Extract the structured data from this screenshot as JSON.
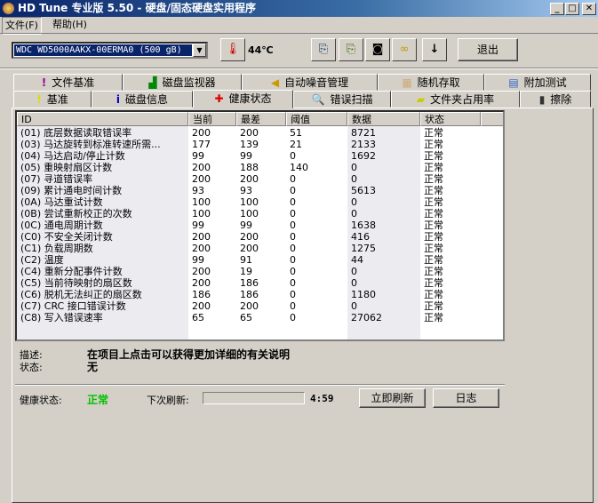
{
  "window": {
    "title": "HD Tune 专业版 5.50 - 硬盘/固态硬盘实用程序"
  },
  "menu": {
    "file": "文件(F)",
    "help": "帮助(H)"
  },
  "toolbar": {
    "drive": "WDC WD5000AAKX-00ERMA0 (500 gB)",
    "temperature": "44℃",
    "exit": "退出"
  },
  "tabs_row1": [
    {
      "label": "文件基准",
      "icon": "file-benchmark-icon"
    },
    {
      "label": "磁盘监视器",
      "icon": "disk-monitor-icon"
    },
    {
      "label": "自动噪音管理",
      "icon": "speaker-icon"
    },
    {
      "label": "随机存取",
      "icon": "random-access-icon"
    },
    {
      "label": "附加测试",
      "icon": "extra-tests-icon"
    }
  ],
  "tabs_row2": [
    {
      "label": "基准",
      "icon": "exclamation-icon"
    },
    {
      "label": "磁盘信息",
      "icon": "info-icon"
    },
    {
      "label": "健康状态",
      "icon": "red-cross-icon",
      "active": true
    },
    {
      "label": "错误扫描",
      "icon": "magnifier-icon"
    },
    {
      "label": "文件夹占用率",
      "icon": "folder-icon"
    },
    {
      "label": "擦除",
      "icon": "trash-icon"
    }
  ],
  "table": {
    "columns": [
      "ID",
      "当前",
      "最差",
      "阈值",
      "数据",
      "状态"
    ],
    "rows": [
      [
        "(01) 底层数据读取错误率",
        "200",
        "200",
        "51",
        "8721",
        "正常"
      ],
      [
        "(03) 马达旋转到标准转速所需...",
        "177",
        "139",
        "21",
        "2133",
        "正常"
      ],
      [
        "(04) 马达启动/停止计数",
        "99",
        "99",
        "0",
        "1692",
        "正常"
      ],
      [
        "(05) 重映射扇区计数",
        "200",
        "188",
        "140",
        "0",
        "正常"
      ],
      [
        "(07) 寻道错误率",
        "200",
        "200",
        "0",
        "0",
        "正常"
      ],
      [
        "(09) 累计通电时间计数",
        "93",
        "93",
        "0",
        "5613",
        "正常"
      ],
      [
        "(0A) 马达重试计数",
        "100",
        "100",
        "0",
        "0",
        "正常"
      ],
      [
        "(0B) 尝试重新校正的次数",
        "100",
        "100",
        "0",
        "0",
        "正常"
      ],
      [
        "(0C) 通电周期计数",
        "99",
        "99",
        "0",
        "1638",
        "正常"
      ],
      [
        "(C0) 不安全关闭计数",
        "200",
        "200",
        "0",
        "416",
        "正常"
      ],
      [
        "(C1) 负载周期数",
        "200",
        "200",
        "0",
        "1275",
        "正常"
      ],
      [
        "(C2) 温度",
        "99",
        "91",
        "0",
        "44",
        "正常"
      ],
      [
        "(C4) 重新分配事件计数",
        "200",
        "19",
        "0",
        "0",
        "正常"
      ],
      [
        "(C5) 当前待映射的扇区数",
        "200",
        "186",
        "0",
        "0",
        "正常"
      ],
      [
        "(C6) 脱机无法纠正的扇区数",
        "186",
        "186",
        "0",
        "1180",
        "正常"
      ],
      [
        "(C7) CRC 接口错误计数",
        "200",
        "200",
        "0",
        "0",
        "正常"
      ],
      [
        "(C8) 写入错误速率",
        "65",
        "65",
        "0",
        "27062",
        "正常"
      ]
    ]
  },
  "details": {
    "desc_label": "描述:",
    "desc_value": "在项目上点击可以获得更加详细的有关说明",
    "status_label": "状态:",
    "status_value": "无"
  },
  "footer": {
    "health_label": "健康状态:",
    "health_value": "正常",
    "health_color": "#00c000",
    "next_refresh_label": "下次刷新:",
    "next_refresh_progress": 0,
    "countdown": "4:59",
    "refresh_button": "立即刷新",
    "log_button": "日志"
  }
}
